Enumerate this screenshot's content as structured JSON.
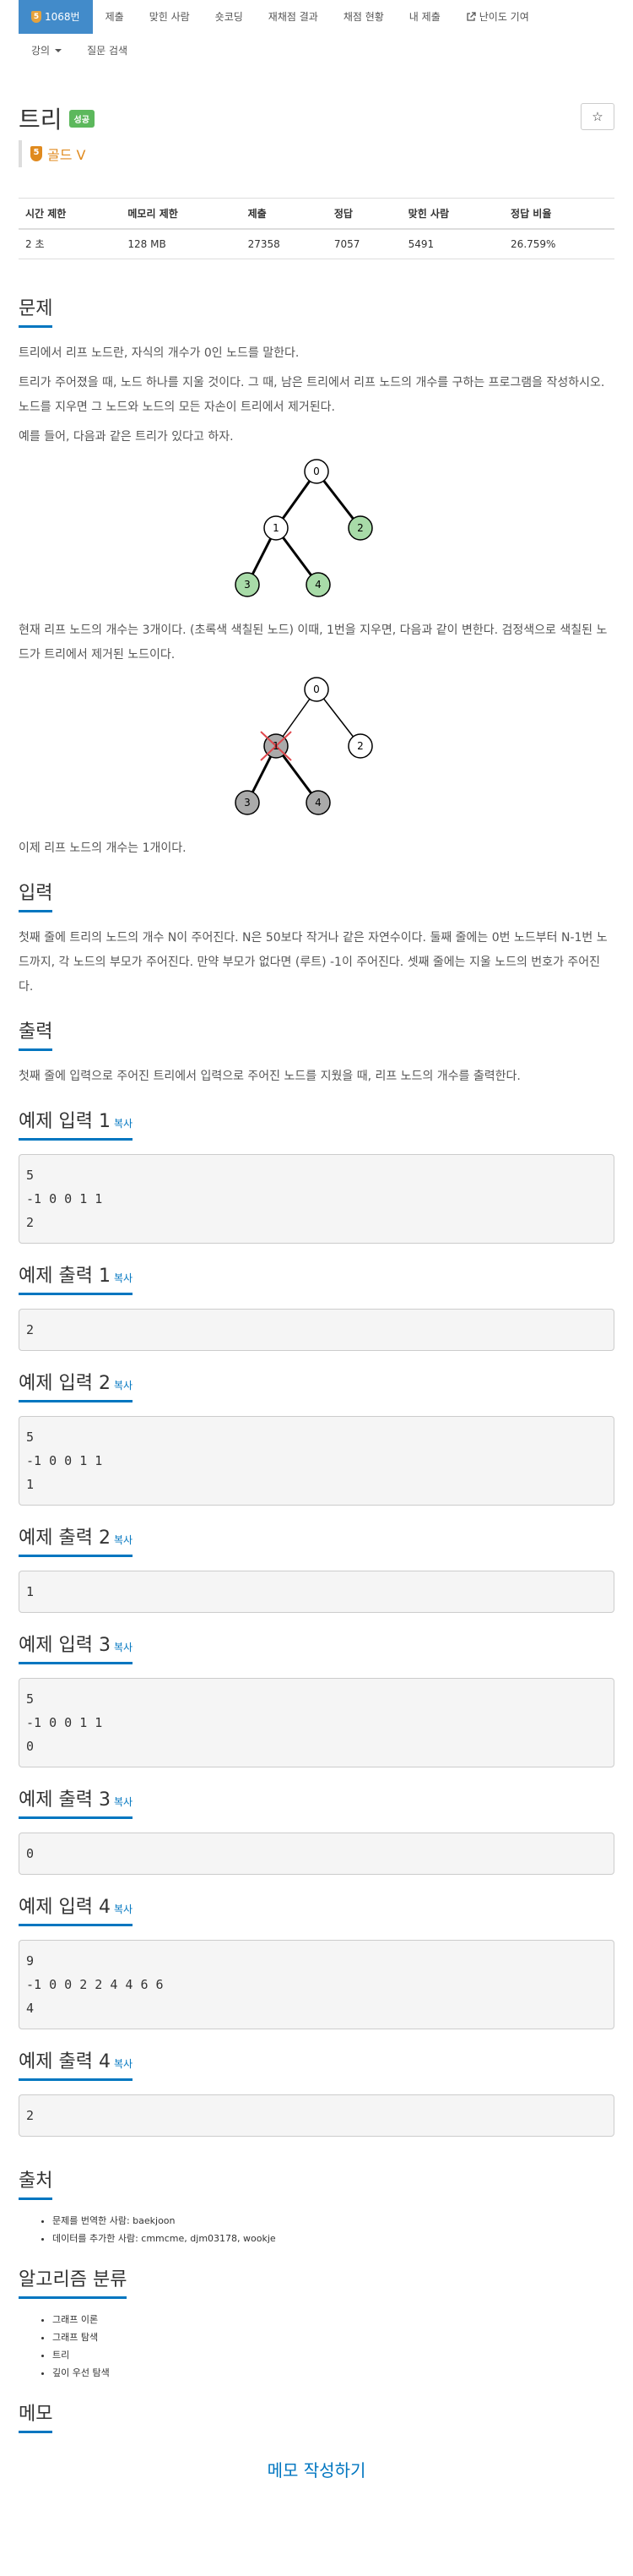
{
  "nav": {
    "items": [
      {
        "label": "1068번",
        "active": true
      },
      {
        "label": "제출"
      },
      {
        "label": "맞힌 사람"
      },
      {
        "label": "숏코딩"
      },
      {
        "label": "재채점 결과"
      },
      {
        "label": "채점 현황"
      },
      {
        "label": "내 제출"
      },
      {
        "label": "난이도 기여"
      }
    ],
    "row2": [
      {
        "label": "강의"
      },
      {
        "label": "질문 검색"
      }
    ]
  },
  "problem": {
    "title": "트리",
    "badge": "성공",
    "tier": "골드 V",
    "tier_num": "5",
    "star": "☆"
  },
  "info": {
    "headers": [
      "시간 제한",
      "메모리 제한",
      "제출",
      "정답",
      "맞힌 사람",
      "정답 비율"
    ],
    "values": [
      "2 초",
      "128 MB",
      "27358",
      "7057",
      "5491",
      "26.759%"
    ]
  },
  "sections": {
    "problem_h": "문제",
    "p1": "트리에서 리프 노드란, 자식의 개수가 0인 노드를 말한다.",
    "p2": "트리가 주어졌을 때, 노드 하나를 지울 것이다. 그 때, 남은 트리에서 리프 노드의 개수를 구하는 프로그램을 작성하시오. 노드를 지우면 그 노드와 노드의 모든 자손이 트리에서 제거된다.",
    "p3": "예를 들어, 다음과 같은 트리가 있다고 하자.",
    "p4": "현재 리프 노드의 개수는 3개이다. (초록색 색칠된 노드) 이때, 1번을 지우면, 다음과 같이 변한다. 검정색으로 색칠된 노드가 트리에서 제거된 노드이다.",
    "p5": "이제 리프 노드의 개수는 1개이다.",
    "input_h": "입력",
    "input_p": "첫째 줄에 트리의 노드의 개수 N이 주어진다. N은 50보다 작거나 같은 자연수이다. 둘째 줄에는 0번 노드부터 N-1번 노드까지, 각 노드의 부모가 주어진다. 만약 부모가 없다면 (루트) -1이 주어진다. 셋째 줄에는 지울 노드의 번호가 주어진다.",
    "output_h": "출력",
    "output_p": "첫째 줄에 입력으로 주어진 트리에서 입력으로 주어진 노드를 지웠을 때, 리프 노드의 개수를 출력한다."
  },
  "tree1": {
    "nodes": [
      "0",
      "1",
      "2",
      "3",
      "4"
    ],
    "leaf_color": "#a8dba8"
  },
  "tree2": {
    "nodes": [
      "0",
      "1",
      "2",
      "3",
      "4"
    ],
    "removed_color": "#aaaaaa",
    "cross_color": "#e0474c"
  },
  "copy_label": "복사",
  "samples": [
    {
      "in_h": "예제 입력 1",
      "in": "5\n-1 0 0 1 1\n2",
      "out_h": "예제 출력 1",
      "out": "2"
    },
    {
      "in_h": "예제 입력 2",
      "in": "5\n-1 0 0 1 1\n1",
      "out_h": "예제 출력 2",
      "out": "1"
    },
    {
      "in_h": "예제 입력 3",
      "in": "5\n-1 0 0 1 1\n0",
      "out_h": "예제 출력 3",
      "out": "0"
    },
    {
      "in_h": "예제 입력 4",
      "in": "9\n-1 0 0 2 2 4 4 6 6\n4",
      "out_h": "예제 출력 4",
      "out": "2"
    }
  ],
  "source": {
    "h": "출처",
    "items": [
      "문제를 번역한 사람: baekjoon",
      "데이터를 추가한 사람: cmmcme, djm03178, wookje"
    ]
  },
  "algo": {
    "h": "알고리즘 분류",
    "items": [
      "그래프 이론",
      "그래프 탐색",
      "트리",
      "깊이 우선 탐색"
    ]
  },
  "memo": {
    "h": "메모",
    "link": "메모 작성하기"
  }
}
